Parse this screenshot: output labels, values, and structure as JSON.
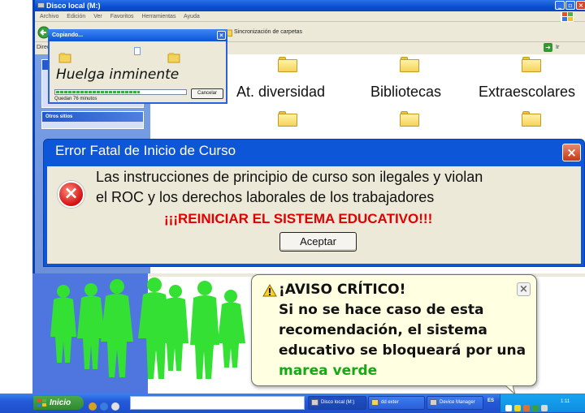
{
  "explorer": {
    "title": "Disco local (M:)",
    "menu": [
      "Archivo",
      "Edición",
      "Ver",
      "Favoritos",
      "Herramientas",
      "Ayuda"
    ],
    "toolbar_sync_label": "Sincronización de carpetas",
    "address_label": "Direc",
    "go_label": "Ir",
    "left_panel_heading": "Otros sitios",
    "folders": [
      "At. diversidad",
      "Bibliotecas",
      "Extraescolares"
    ]
  },
  "copy_dialog": {
    "title": "Copiando...",
    "message": "Huelga inminente",
    "progress": 0.65,
    "remaining": "Quedan 76 minutos",
    "cancel_label": "Cancelar"
  },
  "error_dialog": {
    "title": "Error Fatal de Inicio de Curso",
    "line1": "Las instrucciones de principio de curso son ilegales y violan",
    "line2": "el ROC y los derechos laborales de los trabajadores",
    "alert": "¡¡¡REINICIAR EL SISTEMA EDUCATIVO!!!",
    "accept_label": "Aceptar"
  },
  "balloon": {
    "title": "¡AVISO CRÍTICO!",
    "line1": "Si no se hace caso de esta",
    "line2": "recomendación, el sistema",
    "line3": "educativo se bloqueará por una",
    "highlight": "marea verde",
    "highlight_color": "#17a717"
  },
  "taskbar": {
    "start_label": "Inicio",
    "buttons": [
      "Disco local (M:)",
      "dd exter",
      "Device Manager"
    ],
    "language": "ES",
    "clock": "1:11"
  },
  "colors": {
    "titlebar_blue": "#0e56d8",
    "alert_red": "#e00000",
    "silhouette_green": "#35e035",
    "balloon_bg": "#ffffe1"
  },
  "icons": [
    "folder-icon",
    "error-icon",
    "warning-icon",
    "close-icon",
    "windows-flag-icon",
    "document-icon"
  ]
}
